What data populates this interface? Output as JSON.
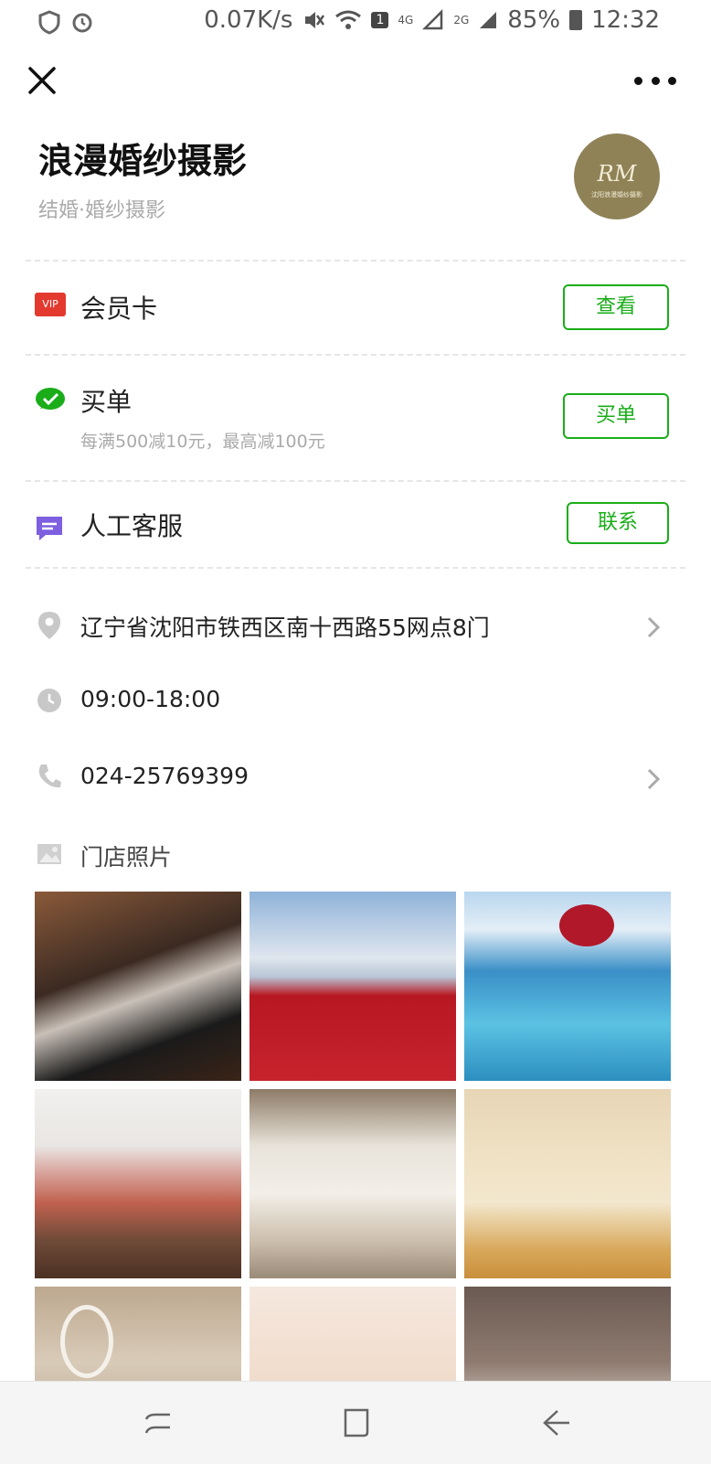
{
  "status_bar": {
    "speed": "0.07K/s",
    "sim_badge": "1",
    "net_4g": "4G",
    "net_2g": "2G",
    "battery": "85%",
    "time": "12:32"
  },
  "header": {
    "title": "浪漫婚纱摄影",
    "subtitle": "结婚·婚纱摄影",
    "logo_text": "RM",
    "logo_subtext": "沈阳浪漫婚纱摄影"
  },
  "actions": {
    "vip_badge": "VIP",
    "membership_label": "会员卡",
    "membership_button": "查看",
    "pay_label": "买单",
    "pay_note": "每满500减10元，最高减100元",
    "pay_button": "买单",
    "service_label": "人工客服",
    "service_button": "联系"
  },
  "info": {
    "address": "辽宁省沈阳市铁西区南十西路55网点8门",
    "hours": "09:00-18:00",
    "phone": "024-25769399"
  },
  "photos": {
    "title": "门店照片"
  },
  "colors": {
    "accent": "#1aad19",
    "vip": "#e3392f",
    "chat": "#7d5fe0"
  }
}
